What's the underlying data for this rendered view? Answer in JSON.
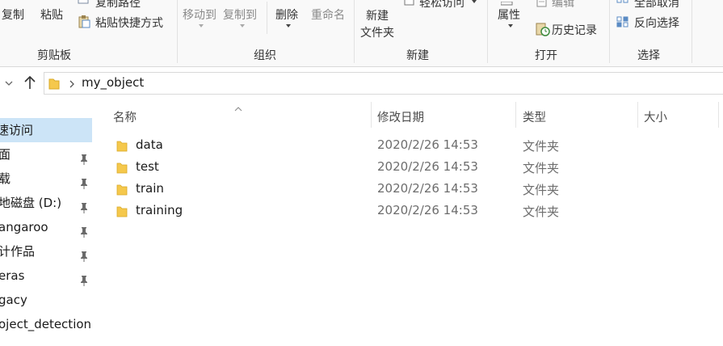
{
  "ribbon": {
    "clipboard": {
      "copy": "复制",
      "paste": "粘贴",
      "copy_path": "复制路径",
      "paste_shortcut": "粘贴快捷方式",
      "group_label": "剪贴板"
    },
    "organize": {
      "move_to": "移动到",
      "copy_to": "复制到",
      "delete": "删除",
      "rename": "重命名",
      "group_label": "组织"
    },
    "new": {
      "new_folder_line1": "新建",
      "new_folder_line2": "文件夹",
      "easy_access": "轻松访问",
      "group_label": "新建"
    },
    "open": {
      "properties": "属性",
      "edit": "编辑",
      "history": "历史记录",
      "group_label": "打开"
    },
    "select": {
      "select_none": "全部取消",
      "invert_selection": "反向选择",
      "group_label": "选择"
    }
  },
  "address": {
    "current_folder": "my_object"
  },
  "nav": {
    "items": [
      {
        "label": "速访问",
        "pinned": false,
        "selected": true
      },
      {
        "label": "面",
        "pinned": true,
        "selected": false
      },
      {
        "label": "载",
        "pinned": true,
        "selected": false
      },
      {
        "label": "地磁盘 (D:)",
        "pinned": true,
        "selected": false
      },
      {
        "label": "angaroo",
        "pinned": true,
        "selected": false
      },
      {
        "label": "计作品",
        "pinned": true,
        "selected": false
      },
      {
        "label": "eras",
        "pinned": true,
        "selected": false
      },
      {
        "label": "gacy",
        "pinned": false,
        "selected": false
      },
      {
        "label": "oject_detection",
        "pinned": false,
        "selected": false
      }
    ]
  },
  "columns": {
    "name": "名称",
    "modified": "修改日期",
    "type": "类型",
    "size": "大小"
  },
  "files": [
    {
      "name": "data",
      "modified": "2020/2/26 14:53",
      "type": "文件夹"
    },
    {
      "name": "test",
      "modified": "2020/2/26 14:53",
      "type": "文件夹"
    },
    {
      "name": "train",
      "modified": "2020/2/26 14:53",
      "type": "文件夹"
    },
    {
      "name": "training",
      "modified": "2020/2/26 14:53",
      "type": "文件夹"
    }
  ],
  "colors": {
    "selection": "#cce4f7",
    "folder": "#f5c84c",
    "ribbon_bg": "#f9f9f9"
  }
}
